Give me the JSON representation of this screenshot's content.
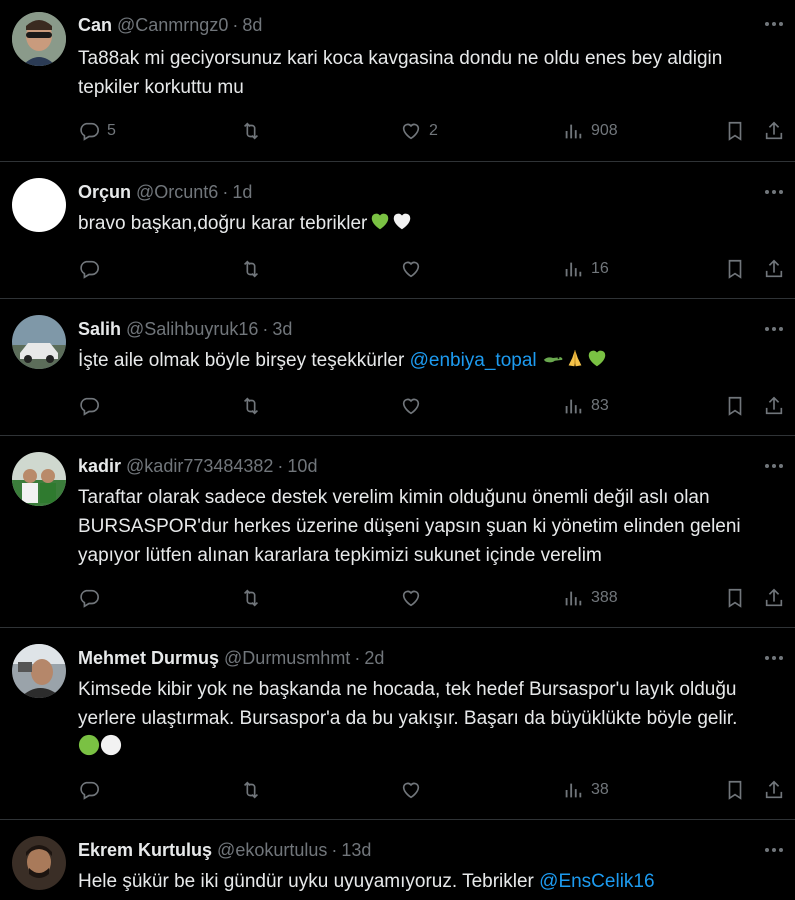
{
  "tweets": [
    {
      "name": "Can",
      "handle": "@Canmrngz0",
      "time": "8d",
      "text": "Ta88ak mi geciyorsunuz kari koca kavgasina dondu ne oldu enes bey aldigin tepkiler korkuttu mu",
      "replies": "5",
      "retweets": "",
      "likes": "2",
      "views": "908"
    },
    {
      "name": "Orçun",
      "handle": "@Orcunt6",
      "time": "1d",
      "text": "bravo başkan,doğru karar tebrikler",
      "replies": "",
      "retweets": "",
      "likes": "",
      "views": "16"
    },
    {
      "name": "Salih",
      "handle": "@Salihbuyruk16",
      "time": "3d",
      "text": "İşte aile olmak böyle birşey teşekkürler",
      "mention": "@enbiya_topal",
      "replies": "",
      "retweets": "",
      "likes": "",
      "views": "83"
    },
    {
      "name": "kadir",
      "handle": "@kadir773484382",
      "time": "10d",
      "text": "Taraftar olarak sadece destek verelim kimin olduğunu önemli değil aslı olan BURSASPOR'dur herkes üzerine düşeni yapsın şuan ki yönetim elinden geleni yapıyor lütfen alınan kararlara tepkimizi sukunet içinde verelim",
      "replies": "",
      "retweets": "",
      "likes": "",
      "views": "388"
    },
    {
      "name": "Mehmet Durmuş",
      "handle": "@Durmusmhmt",
      "time": "2d",
      "text": "Kimsede kibir yok ne başkanda ne hocada, tek hedef Bursaspor'u layık olduğu yerlere ulaştırmak. Bursaspor'a da bu yakışır. Başarı da büyüklükte böyle gelir.",
      "replies": "",
      "retweets": "",
      "likes": "",
      "views": "38"
    },
    {
      "name": "Ekrem Kurtuluş",
      "handle": "@ekokurtulus",
      "time": "13d",
      "text": "Hele şükür be iki gündür uyku uyuyamıyoruz. Tebrikler",
      "mention": "@EnsCelik16"
    }
  ],
  "separator": "·",
  "colors": {
    "background": "#000000",
    "text": "#e7e9ea",
    "muted": "#71767b",
    "link": "#1d9bf0",
    "divider": "#2f3336"
  },
  "icons": [
    "more-icon",
    "reply-icon",
    "retweet-icon",
    "like-icon",
    "views-icon",
    "bookmark-icon",
    "share-icon"
  ]
}
